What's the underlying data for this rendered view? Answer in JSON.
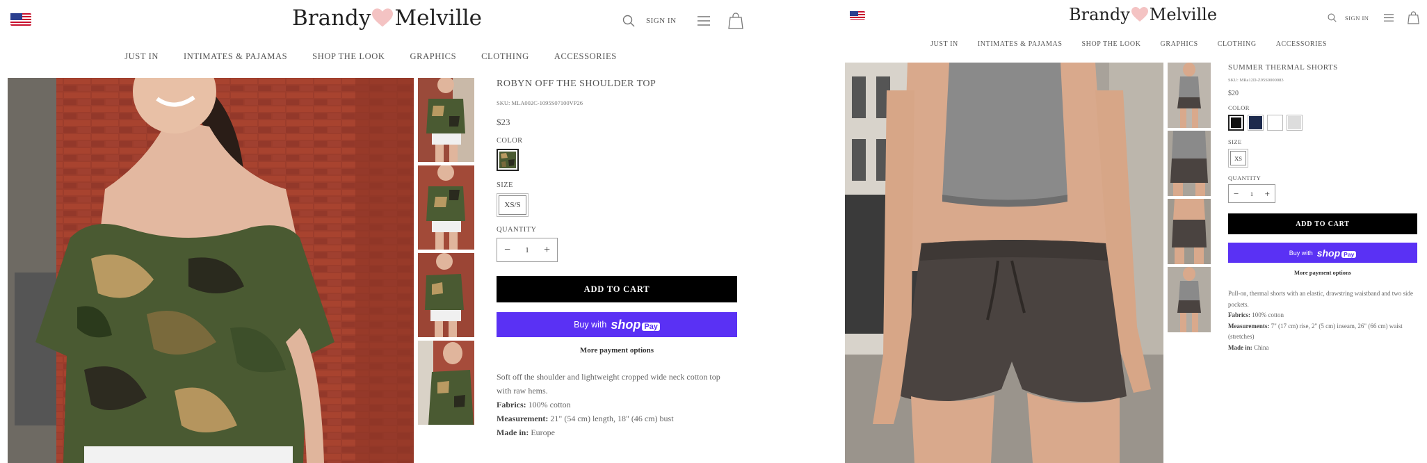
{
  "brand": {
    "name_left": "Brandy",
    "name_right": "Melville",
    "heart_icon": "heart-icon"
  },
  "colors": {
    "shop_pay": "#5a31f4",
    "cart_button": "#000000",
    "heart": "#f4c3c3"
  },
  "header": {
    "signin_label": "SIGN IN"
  },
  "nav": [
    "JUST IN",
    "INTIMATES & PAJAMAS",
    "SHOP THE LOOK",
    "GRAPHICS",
    "CLOTHING",
    "ACCESSORIES"
  ],
  "left_product": {
    "title": "ROBYN OFF THE SHOULDER TOP",
    "sku": "SKU: MLA002C-1095S07100VP26",
    "price": "$23",
    "color_label": "COLOR",
    "size_label": "SIZE",
    "size": "XS/S",
    "quantity_label": "QUANTITY",
    "quantity": "1",
    "add_to_cart": "ADD TO CART",
    "buy_with": "Buy with",
    "shop_word": "shop",
    "pay_word": "Pay",
    "more_payment": "More payment options",
    "description": "Soft off the shoulder and lightweight cropped wide neck cotton top with raw hems.",
    "fabrics_label": "Fabrics:",
    "fabrics": "100% cotton",
    "measurement_label": "Measurement:",
    "measurement": "21\" (54 cm) length, 18\" (46 cm) bust",
    "made_in_label": "Made in:",
    "made_in": "Europe"
  },
  "right_product": {
    "title": "SUMMER THERMAL SHORTS",
    "sku": "SKU: MRa12D-Z95S0000083",
    "price": "$20",
    "color_label": "COLOR",
    "size_label": "SIZE",
    "size": "XS",
    "quantity_label": "QUANTITY",
    "quantity": "1",
    "add_to_cart": "ADD TO CART",
    "buy_with": "Buy with",
    "shop_word": "shop",
    "pay_word": "Pay",
    "more_payment": "More payment options",
    "description": "Pull-on, thermal shorts with an elastic, drawstring waistband and two side pockets.",
    "fabrics_label": "Fabrics:",
    "fabrics": "100% cotton",
    "measurements_label": "Measurements:",
    "measurements": "7\" (17 cm) rise, 2\" (5 cm) inseam, 26\" (66 cm) waist (stretches)",
    "made_in_label": "Made in:",
    "made_in": "China",
    "swatch_colors": [
      "#111111",
      "#1d2a4d",
      "#ffffff",
      "#dddddd"
    ]
  }
}
